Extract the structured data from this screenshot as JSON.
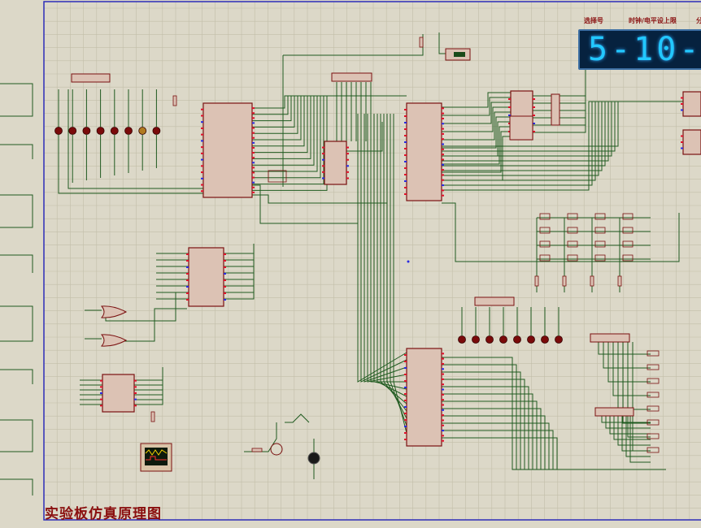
{
  "sheet": {
    "title": "实验板仿真原理图"
  },
  "display": {
    "text": "5-10-",
    "labels": [
      "选择号",
      "时钟/电平设上限",
      "分"
    ]
  },
  "colors": {
    "background": "#dcd8c8",
    "grid": "#c2bea9",
    "sheet_border": "#2c2cb8",
    "wire": "#1f5a1f",
    "chip_fill": "#dcc2b4",
    "chip_border": "#7a1010",
    "pin_red": "#e0102a",
    "pin_blue": "#2a2ae0",
    "led": "#7a0a0a",
    "display_bg": "#06223f",
    "display_digits": "#22c8ff",
    "title_text": "#8a0f0f"
  }
}
